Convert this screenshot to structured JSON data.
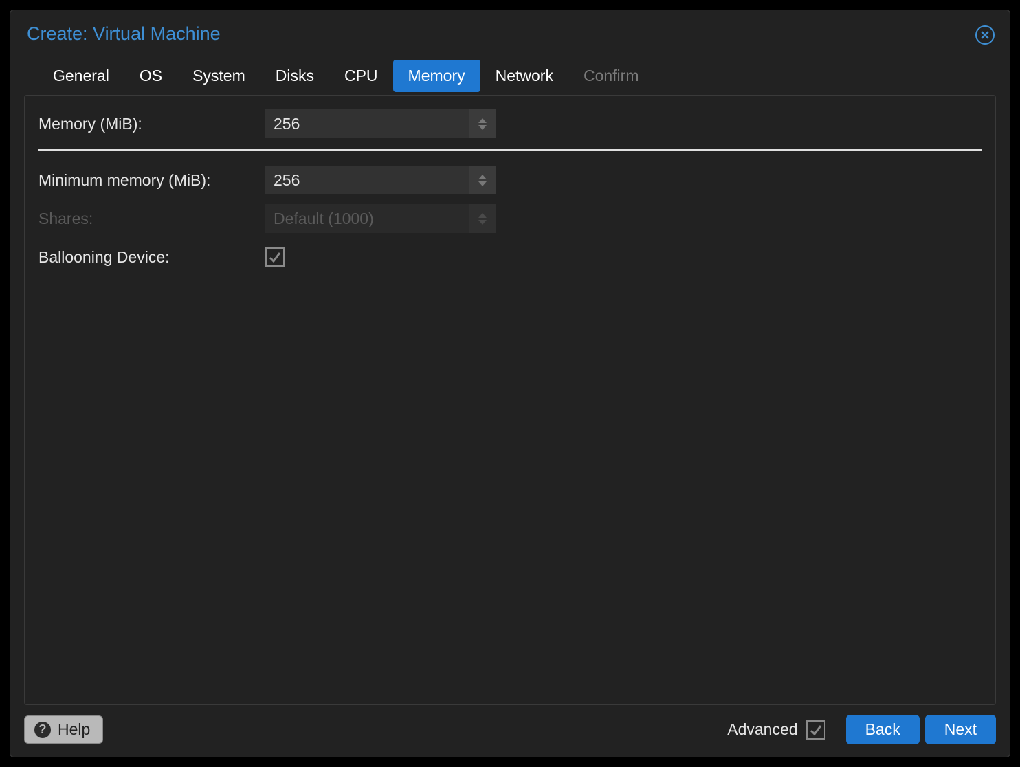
{
  "title": "Create: Virtual Machine",
  "tabs": [
    {
      "label": "General"
    },
    {
      "label": "OS"
    },
    {
      "label": "System"
    },
    {
      "label": "Disks"
    },
    {
      "label": "CPU"
    },
    {
      "label": "Memory"
    },
    {
      "label": "Network"
    },
    {
      "label": "Confirm"
    }
  ],
  "active_tab": "Memory",
  "form": {
    "memory_label": "Memory (MiB):",
    "memory_value": "256",
    "min_memory_label": "Minimum memory (MiB):",
    "min_memory_value": "256",
    "shares_label": "Shares:",
    "shares_value": "Default (1000)",
    "ballooning_label": "Ballooning Device:",
    "ballooning_checked": true
  },
  "footer": {
    "help_label": "Help",
    "advanced_label": "Advanced",
    "advanced_checked": true,
    "back_label": "Back",
    "next_label": "Next"
  },
  "colors": {
    "accent": "#1f78d1",
    "link": "#3e8fd4"
  }
}
